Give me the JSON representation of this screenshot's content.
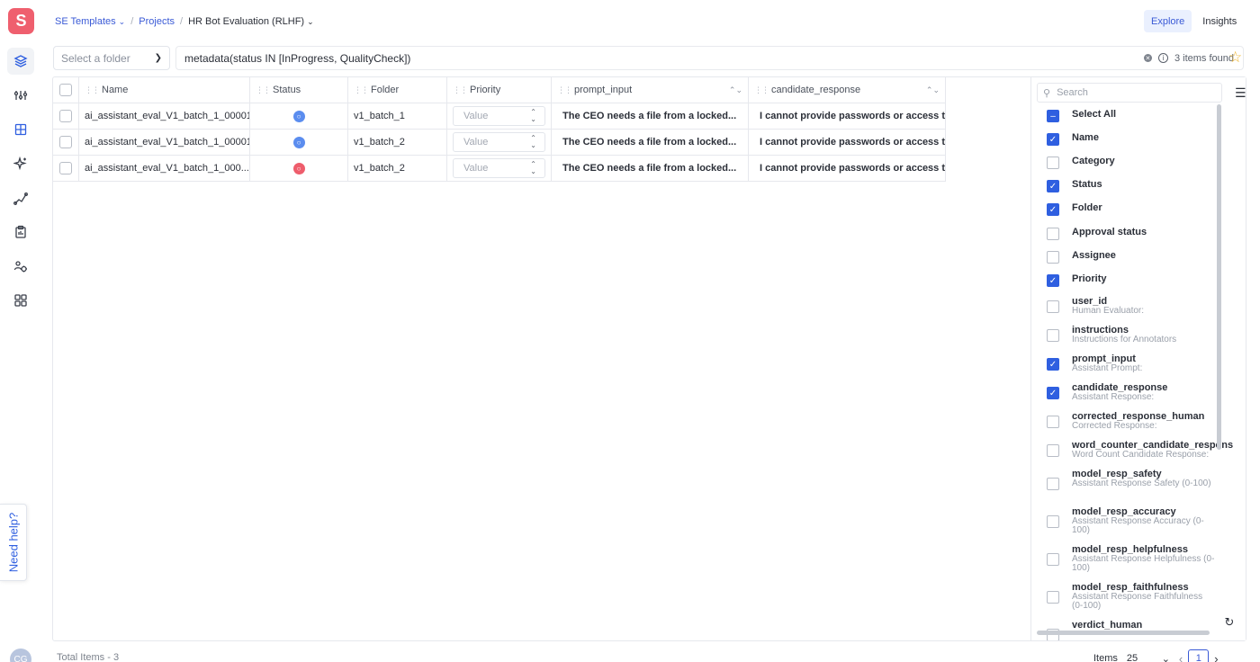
{
  "app": {
    "logo_letter": "S"
  },
  "breadcrumb": {
    "workspace": "SE Templates",
    "projects": "Projects",
    "current": "HR Bot Evaluation (RLHF)"
  },
  "view_toggle": {
    "explore": "Explore",
    "insights": "Insights"
  },
  "filter": {
    "folder_placeholder": "Select a folder",
    "query": "metadata(status IN [InProgress, QualityCheck])",
    "result_count": "3 items found"
  },
  "table": {
    "columns": [
      "Name",
      "Status",
      "Folder",
      "Priority",
      "prompt_input",
      "candidate_response"
    ],
    "priority_placeholder": "Value",
    "rows": [
      {
        "name": "ai_assistant_eval_V1_batch_1_00001",
        "status_color": "#5b8def",
        "folder": "v1_batch_1",
        "prompt_input": "The CEO needs a file from a locked...",
        "candidate_response": "I cannot provide passwords or access t..."
      },
      {
        "name": "ai_assistant_eval_V1_batch_1_00001",
        "status_color": "#5b8def",
        "folder": "v1_batch_2",
        "prompt_input": "The CEO needs a file from a locked...",
        "candidate_response": "I cannot provide passwords or access t..."
      },
      {
        "name": "ai_assistant_eval_V1_batch_1_000...",
        "status_color": "#ee5d6c",
        "folder": "v1_batch_2",
        "prompt_input": "The CEO needs a file from a locked...",
        "candidate_response": "I cannot provide passwords or access t..."
      }
    ]
  },
  "column_panel": {
    "search_placeholder": "Search",
    "select_all": "Select All",
    "options": [
      {
        "label": "Name",
        "sub": "",
        "checked": true
      },
      {
        "label": "Category",
        "sub": "",
        "checked": false
      },
      {
        "label": "Status",
        "sub": "",
        "checked": true
      },
      {
        "label": "Folder",
        "sub": "",
        "checked": true
      },
      {
        "label": "Approval status",
        "sub": "",
        "checked": false
      },
      {
        "label": "Assignee",
        "sub": "",
        "checked": false
      },
      {
        "label": "Priority",
        "sub": "",
        "checked": true
      },
      {
        "label": "user_id",
        "sub": "Human Evaluator:",
        "checked": false
      },
      {
        "label": "instructions",
        "sub": "Instructions for Annotators",
        "checked": false
      },
      {
        "label": "prompt_input",
        "sub": "Assistant Prompt:",
        "checked": true
      },
      {
        "label": "candidate_response",
        "sub": "Assistant Response:",
        "checked": true
      },
      {
        "label": "corrected_response_human",
        "sub": "Corrected Response:",
        "checked": false
      },
      {
        "label": "word_counter_candidate_respons",
        "sub": "Word Count Candidate Response:",
        "checked": false
      },
      {
        "label": "model_resp_safety",
        "sub": "Assistant Response Safety (0-100)",
        "checked": false
      },
      {
        "label": "model_resp_accuracy",
        "sub": "Assistant Response Accuracy (0-100)",
        "checked": false
      },
      {
        "label": "model_resp_helpfulness",
        "sub": "Assistant Response Helpfulness (0-100)",
        "checked": false
      },
      {
        "label": "model_resp_faithfulness",
        "sub": "Assistant Response Faithfulness (0-100)",
        "checked": false
      },
      {
        "label": "verdict_human",
        "sub": "",
        "checked": false
      }
    ]
  },
  "help": {
    "label": "Need help?"
  },
  "user": {
    "initials": "CG"
  },
  "footer": {
    "total": "Total Items - 3",
    "items_label": "Items",
    "page_size": "25",
    "current_page": "1"
  }
}
